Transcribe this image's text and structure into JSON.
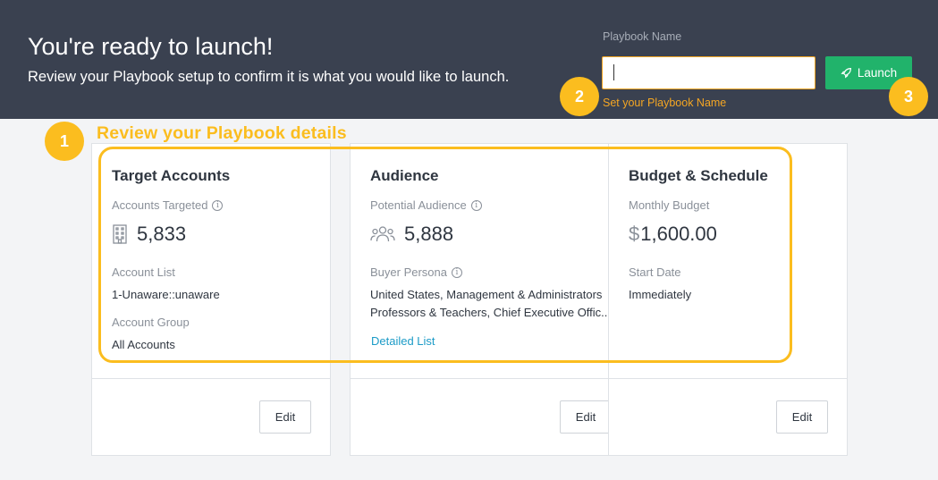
{
  "header": {
    "title": "You're ready to launch!",
    "subtitle": "Review your Playbook setup to confirm it is what you would like to launch.",
    "playbook_name_label": "Playbook Name",
    "playbook_name_value": "",
    "playbook_name_hint": "Set your Playbook Name",
    "launch_label": "Launch"
  },
  "annotations": {
    "step1": "1",
    "step2": "2",
    "step3": "3",
    "review_title": "Review your Playbook details"
  },
  "cards": {
    "target": {
      "title": "Target Accounts",
      "accounts_label": "Accounts Targeted",
      "accounts_value": "5,833",
      "list_label": "Account List",
      "list_value": "1-Unaware::unaware",
      "group_label": "Account Group",
      "group_value": "All Accounts",
      "edit_label": "Edit"
    },
    "audience": {
      "title": "Audience",
      "potential_label": "Potential Audience",
      "potential_value": "5,888",
      "persona_label": "Buyer Persona",
      "persona_line1": "United States, Management & Administrators",
      "persona_line2": "Professors & Teachers, Chief Executive Offic...",
      "detail_link": "Detailed List",
      "edit_label": "Edit"
    },
    "budget": {
      "title": "Budget & Schedule",
      "budget_label": "Monthly Budget",
      "currency": "$",
      "budget_value": "1,600.00",
      "start_label": "Start Date",
      "start_value": "Immediately",
      "edit_label": "Edit"
    }
  },
  "colors": {
    "header_bg": "#3a4150",
    "accent": "#fbbd1f",
    "launch": "#21b36b",
    "link": "#1c9bc7"
  }
}
